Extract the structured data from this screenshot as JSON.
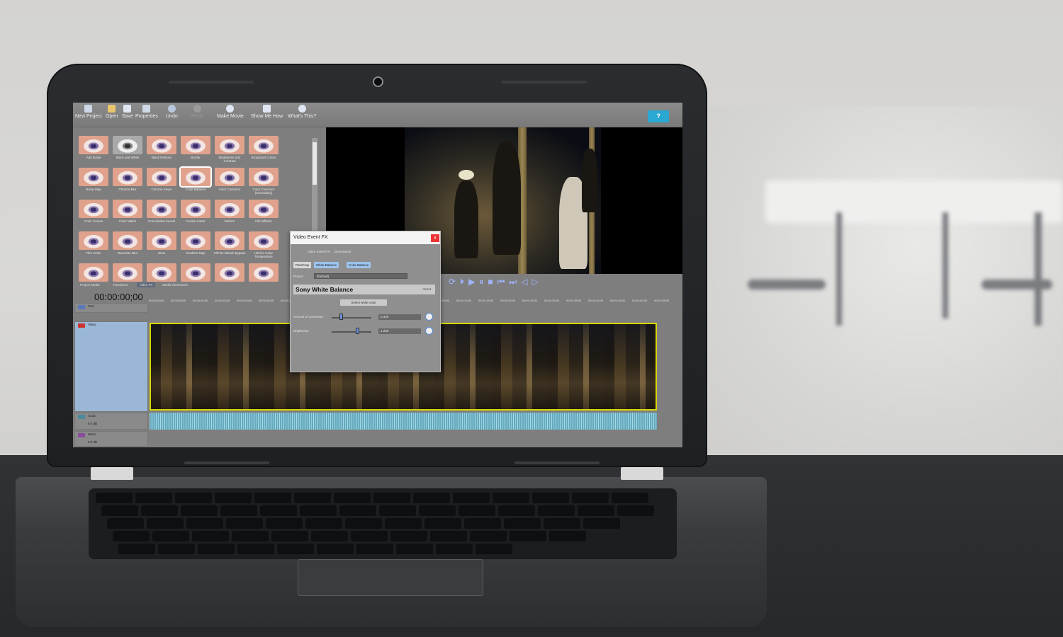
{
  "toolbar": {
    "new_project": "New Project",
    "open": "Open",
    "save": "Save",
    "properties": "Properties",
    "undo": "Undo",
    "redo": "Redo",
    "make_movie": "Make Movie",
    "show_me_how": "Show Me How",
    "whats_this": "What's This?"
  },
  "help_label": "?",
  "fx_items": [
    "Add Noise",
    "Black and White",
    "Black Restore",
    "Border",
    "Brightness and Contrast",
    "Broadcast Colors",
    "Bump Map",
    "Chroma Blur",
    "Chroma Keyer",
    "Color Balance",
    "Color Corrector",
    "Color Corrector (Secondary)",
    "Color Curves",
    "Color Match",
    "Convolution Kernel",
    "Cookie Cutter",
    "Deform",
    "Film Effects",
    "Film Grain",
    "Gaussian Blur",
    "Glow",
    "Gradient Map",
    "HitFilm Bleach Bypass",
    "HitFilm Color Temperature"
  ],
  "panel_tabs": [
    "Project Media",
    "Transitions",
    "Video FX",
    "Media Generators"
  ],
  "timecode": "00:00:00;00",
  "ruler": [
    "00:00:00;00",
    "00:00:05;00",
    "00:00:10;00",
    "00:00:15;00",
    "00:00:20;00",
    "00:00:25;00",
    "00:00:30;00",
    "00:00:35;00",
    "00:00:40;00",
    "00:00:45;00",
    "00:00:50;00",
    "00:00:55;00",
    "00:01:00;00",
    "00:01:05;00",
    "00:01:10;00",
    "00:01:15;00",
    "00:01:20;00",
    "00:01:25;00",
    "00:01:30;00",
    "00:01:35;00",
    "00:01:40;00",
    "00:01:45;00",
    "00:01:50;00",
    "00:01:55;00"
  ],
  "tracks": {
    "text": "Text",
    "video": "Video",
    "audio": "Audio",
    "music": "Music",
    "audio_vol": "0.0 dB",
    "music_vol": "0.0 dB"
  },
  "dialog": {
    "title": "Video Event FX",
    "close": "x",
    "event_label": "Video Event FX:",
    "event_name": "Drummers2",
    "chips": [
      "Pan/Crop",
      "White Balance",
      "Color Balance"
    ],
    "preset_label": "Preset:",
    "preset_value": "(Default)",
    "plugin_name": "Sony White Balance",
    "about": "About",
    "select_btn": "Select white color",
    "amount_label": "Amount of correction:",
    "amount_value": "0.336",
    "brightness_label": "Brightness:",
    "brightness_value": "1.269",
    "amount_level": 0.2,
    "brightness_level": 0.6
  },
  "transport_icons": [
    "loop-icon",
    "play-from-start-icon",
    "play-icon",
    "pause-icon",
    "stop-icon",
    "go-to-start-icon",
    "go-to-end-icon",
    "previous-frame-icon",
    "next-frame-icon"
  ]
}
